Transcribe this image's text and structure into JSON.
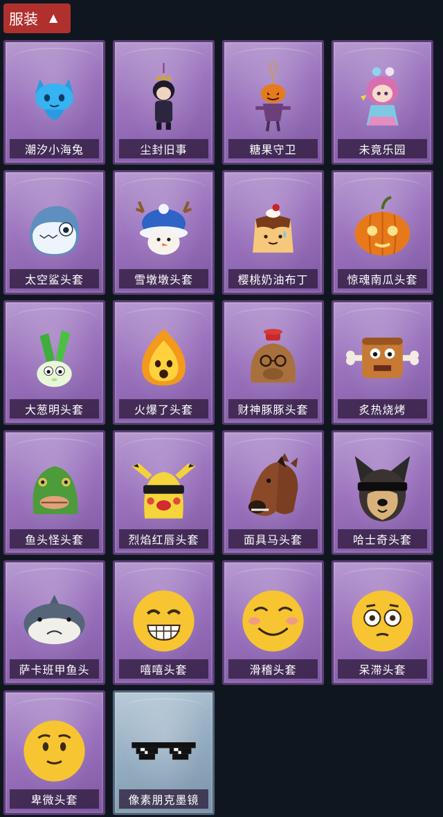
{
  "header": {
    "title": "服装",
    "toggle_icon": "chevron-up-icon"
  },
  "items": [
    {
      "name": "潮汐小海兔",
      "icon": "sea-rabbit-icon"
    },
    {
      "name": "尘封旧事",
      "icon": "dark-costume-doll-icon"
    },
    {
      "name": "糖果守卫",
      "icon": "pumpkin-scarecrow-charm-icon"
    },
    {
      "name": "未竟乐园",
      "icon": "pink-hair-doll-icon"
    },
    {
      "name": "太空鲨头套",
      "icon": "shark-head-icon"
    },
    {
      "name": "雪墩墩头套",
      "icon": "snowman-head-icon"
    },
    {
      "name": "樱桃奶油布丁",
      "icon": "pudding-head-icon"
    },
    {
      "name": "惊魂南瓜头套",
      "icon": "pumpkin-head-icon"
    },
    {
      "name": "大葱明头套",
      "icon": "scallion-head-icon"
    },
    {
      "name": "火爆了头套",
      "icon": "fire-head-icon"
    },
    {
      "name": "财神豚豚头套",
      "icon": "capybara-head-icon"
    },
    {
      "name": "炙热烧烤",
      "icon": "bbq-meat-icon"
    },
    {
      "name": "鱼头怪头套",
      "icon": "fish-head-icon"
    },
    {
      "name": "烈焰红唇头套",
      "icon": "yellow-mascot-head-icon"
    },
    {
      "name": "面具马头套",
      "icon": "horse-mask-icon"
    },
    {
      "name": "哈士奇头套",
      "icon": "husky-head-icon"
    },
    {
      "name": "萨卡班甲鱼头",
      "icon": "sacabambaspis-head-icon"
    },
    {
      "name": "嘻嘻头套",
      "icon": "grin-emoji-head-icon"
    },
    {
      "name": "滑稽头套",
      "icon": "silly-smile-emoji-head-icon"
    },
    {
      "name": "呆滞头套",
      "icon": "blank-stare-emoji-head-icon"
    },
    {
      "name": "卑微头套",
      "icon": "humble-emoji-head-icon"
    },
    {
      "name": "像素朋克墨镜",
      "icon": "pixel-sunglasses-icon"
    }
  ],
  "colors": {
    "header_bg": "#b0302e",
    "card_purple": "#9a72bd",
    "card_blue": "#94acc0",
    "page_bg": "#0f1620"
  }
}
